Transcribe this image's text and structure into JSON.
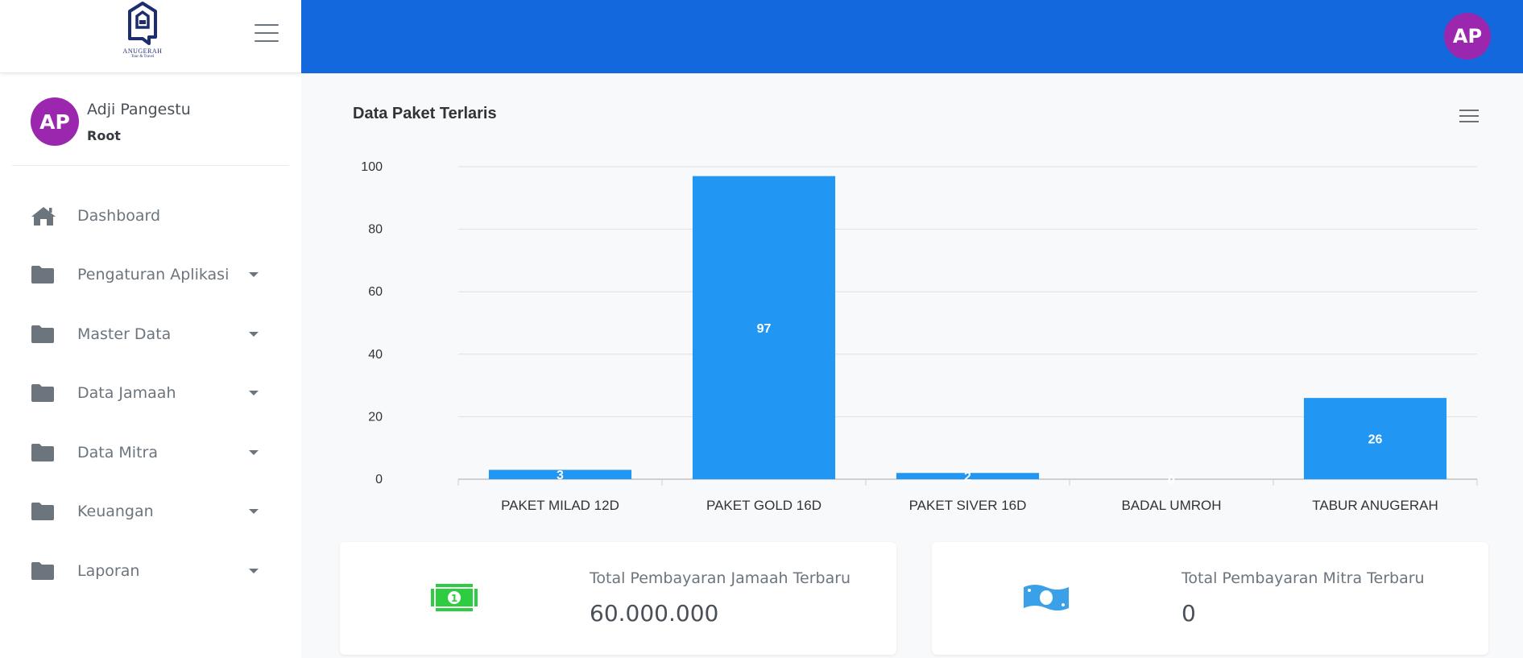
{
  "brand": {
    "logo_name": "ANUGERAH",
    "logo_sub": "Tour & Travel"
  },
  "user": {
    "initials": "AP",
    "name": "Adji Pangestu",
    "role": "Root"
  },
  "sidebar": {
    "items": [
      {
        "label": "Dashboard",
        "icon": "home-icon",
        "has_caret": false
      },
      {
        "label": "Pengaturan Aplikasi",
        "icon": "folder-icon",
        "has_caret": true
      },
      {
        "label": "Master Data",
        "icon": "folder-icon",
        "has_caret": true
      },
      {
        "label": "Data Jamaah",
        "icon": "folder-icon",
        "has_caret": true
      },
      {
        "label": "Data Mitra",
        "icon": "folder-icon",
        "has_caret": true
      },
      {
        "label": "Keuangan",
        "icon": "folder-icon",
        "has_caret": true
      },
      {
        "label": "Laporan",
        "icon": "folder-icon",
        "has_caret": true
      }
    ]
  },
  "header": {
    "avatar_initials": "AP",
    "color": "#1468dd"
  },
  "chart_data": {
    "type": "bar",
    "title": "Data Paket Terlaris",
    "categories": [
      "PAKET MILAD 12D",
      "PAKET GOLD 16D",
      "PAKET SIVER 16D",
      "BADAL UMROH",
      "TABUR ANUGERAH"
    ],
    "values": [
      3,
      97,
      2,
      0,
      26
    ],
    "ylim": [
      0,
      100
    ],
    "yticks": [
      0,
      20,
      40,
      60,
      80,
      100
    ],
    "xlabel": "",
    "ylabel": "",
    "grid": true,
    "bar_color": "#2196f3"
  },
  "stats": {
    "jamaah": {
      "label": "Total Pembayaran Jamaah Terbaru",
      "value": "60.000.000",
      "icon": "cash-icon",
      "color": "#2ecc40"
    },
    "mitra": {
      "label": "Total Pembayaran Mitra Terbaru",
      "value": "0",
      "icon": "money-icon",
      "color": "#3aa0e8"
    }
  }
}
